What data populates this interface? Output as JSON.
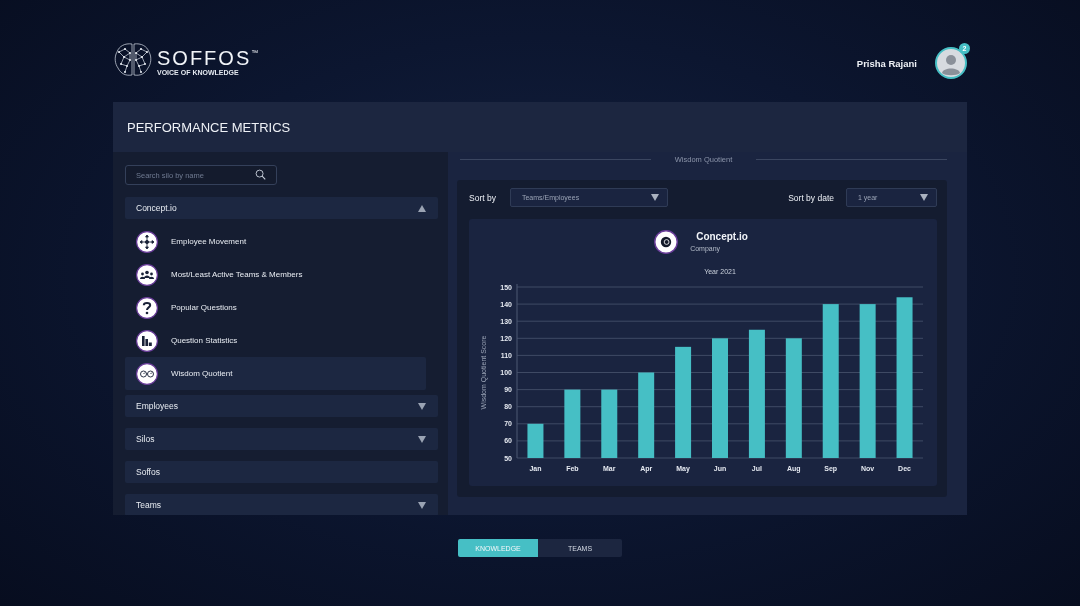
{
  "header": {
    "brand": "SOFFOS$^{™}$",
    "tagline": "VOICE OF KNOWLEDGE",
    "user": {
      "name": "Prisha Rajani",
      "notifications": "2"
    }
  },
  "panel": {
    "title": "PERFORMANCE METRICS"
  },
  "sidebar": {
    "search": {
      "placeholder": "Search silo by name"
    },
    "sections": [
      {
        "label": "Concept.io",
        "kind": "expandable",
        "expanded": true,
        "children": [
          {
            "label": "Employee Movement",
            "selected": false
          },
          {
            "label": "Most/Least Active Teams & Members",
            "selected": false
          },
          {
            "label": "Popular Questions",
            "selected": false
          },
          {
            "label": "Question Statistics",
            "selected": false
          },
          {
            "label": "Wisdom Quotient",
            "selected": true
          }
        ]
      },
      {
        "label": "Employees",
        "kind": "expandable",
        "expanded": false
      },
      {
        "label": "Silos",
        "kind": "expandable",
        "expanded": false
      },
      {
        "label": "Soffos",
        "kind": "plain"
      },
      {
        "label": "Teams",
        "kind": "expandable",
        "expanded": false
      }
    ]
  },
  "report": {
    "title": "Wisdom Quotient",
    "filters": [
      {
        "label": "Sort by",
        "value": "Teams/Employees"
      },
      {
        "label": "Sort by date",
        "value": "1 year"
      }
    ],
    "entity": {
      "name": "Concept.io",
      "type": "Company"
    },
    "chart_data": {
      "type": "bar",
      "title": "Year 2021",
      "ylabel": "Wisdom Quotient Score",
      "categories": [
        "Jan",
        "Feb",
        "Mar",
        "Apr",
        "May",
        "Jun",
        "Jul",
        "Aug",
        "Sep",
        "Nov",
        "Dec"
      ],
      "values": [
        70,
        90,
        90,
        100,
        115,
        120,
        125,
        120,
        140,
        140,
        144
      ],
      "ylim": [
        50,
        150
      ],
      "yticks": [
        50,
        60,
        70,
        80,
        90,
        100,
        110,
        120,
        130,
        140,
        150
      ],
      "grid": true
    }
  },
  "bottom_tabs": [
    {
      "label": "KNOWLEDGE",
      "selected": true
    },
    {
      "label": "TEAMS",
      "selected": false
    }
  ]
}
